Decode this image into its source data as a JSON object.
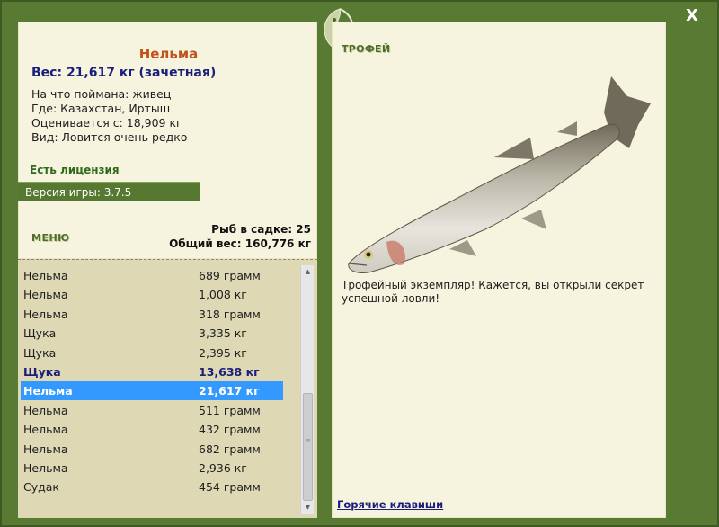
{
  "window": {
    "close_label": "X"
  },
  "fish": {
    "name": "Нельма",
    "weight_line": "Вес: 21,617 кг (зачетная)",
    "caught_on": "На что поймана: живец",
    "location": "Где: Казахстан, Иртыш",
    "valued_from": "Оценивается с: 18,909 кг",
    "kind": "Вид: Ловится очень редко"
  },
  "license": "Есть лицензия",
  "version": "Версия игры: 3.7.5",
  "menu_label": "МЕНЮ",
  "stats": {
    "fish_count": "Рыб в садке: 25",
    "total_weight": "Общий вес: 160,776 кг"
  },
  "catch_list": [
    {
      "name": "Нельма",
      "weight": "689 грамм",
      "style": "normal"
    },
    {
      "name": "Нельма",
      "weight": "1,008 кг",
      "style": "normal"
    },
    {
      "name": "Нельма",
      "weight": "318 грамм",
      "style": "normal"
    },
    {
      "name": "Щука",
      "weight": "3,335 кг",
      "style": "normal"
    },
    {
      "name": "Щука",
      "weight": "2,395 кг",
      "style": "normal"
    },
    {
      "name": "Щука",
      "weight": "13,638 кг",
      "style": "bold"
    },
    {
      "name": "Нельма",
      "weight": "21,617 кг",
      "style": "selected"
    },
    {
      "name": "Нельма",
      "weight": "511 грамм",
      "style": "normal"
    },
    {
      "name": "Нельма",
      "weight": "432 грамм",
      "style": "normal"
    },
    {
      "name": "Нельма",
      "weight": "682 грамм",
      "style": "normal"
    },
    {
      "name": "Нельма",
      "weight": "2,936 кг",
      "style": "normal"
    },
    {
      "name": "Судак",
      "weight": "454 грамм",
      "style": "normal"
    }
  ],
  "trophy": {
    "title": "ТРОФЕЙ",
    "text": "Трофейный экземпляр! Кажется, вы открыли секрет успешной ловли!"
  },
  "hotkeys_label": "Горячие клавиши",
  "colors": {
    "frame": "#597a33",
    "panel": "#f6f3df",
    "list_bg": "#ded8b5",
    "selected": "#3399ff",
    "fish_name": "#c0521a",
    "accent_blue": "#1a1d7a"
  }
}
